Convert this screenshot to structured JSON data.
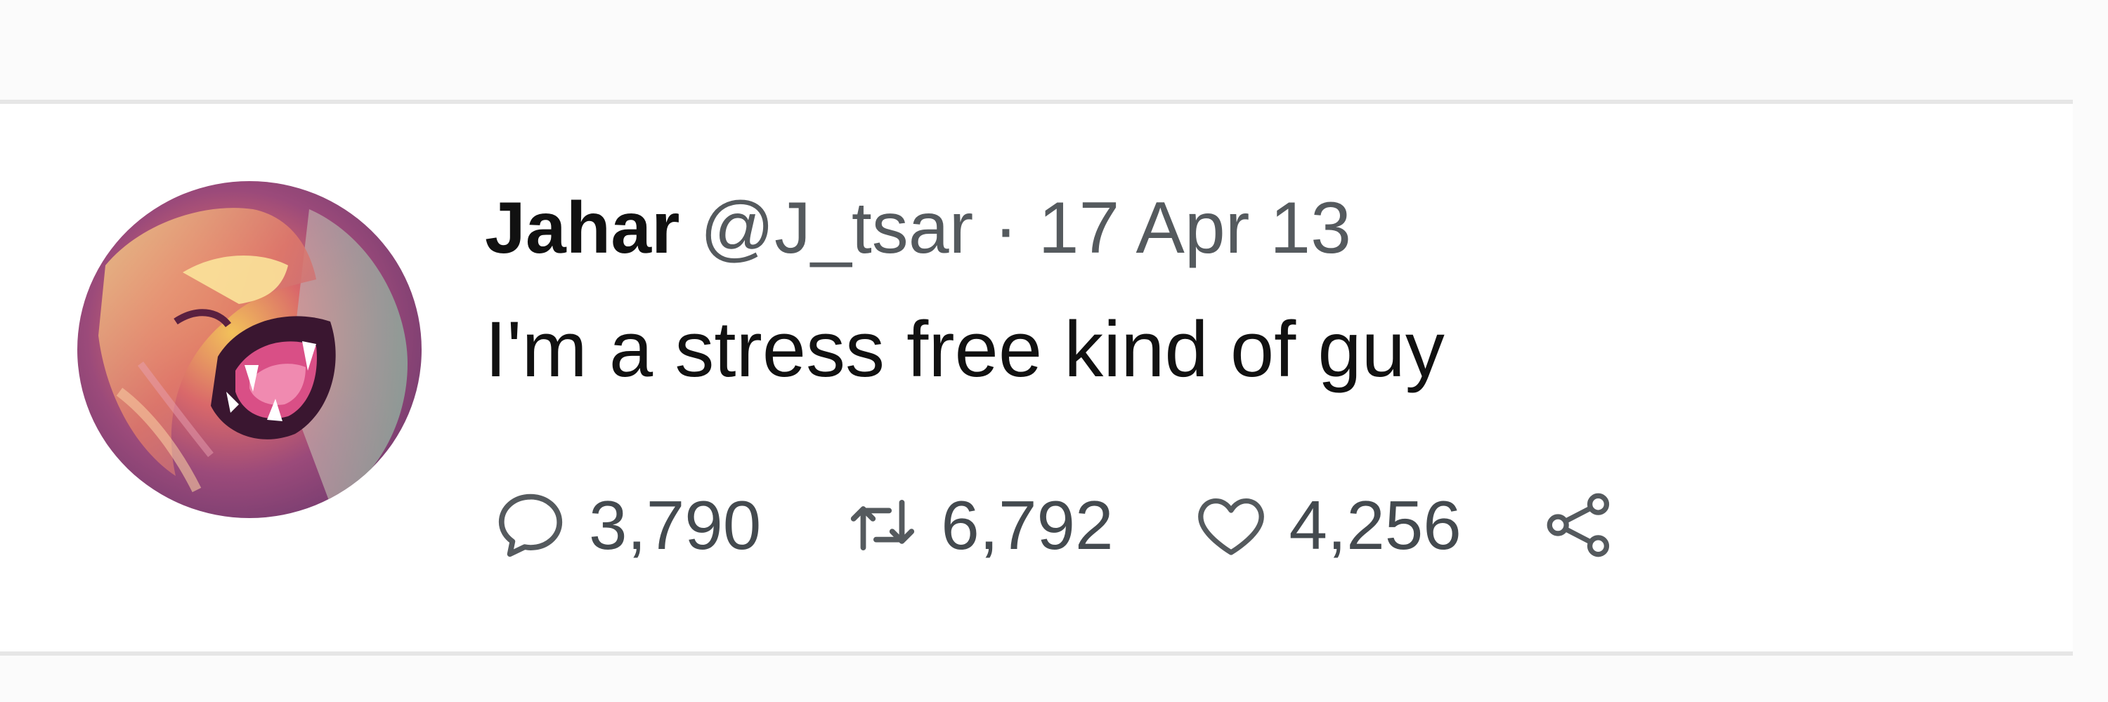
{
  "tweet": {
    "display_name": "Jahar",
    "handle": "@J_tsar",
    "separator": "·",
    "date": "17 Apr 13",
    "text": "I'm a stress free kind of guy",
    "avatar": "lion-roaring-avatar"
  },
  "actions": {
    "reply": {
      "icon": "reply-icon",
      "count": "3,790"
    },
    "retweet": {
      "icon": "retweet-icon",
      "count": "6,792"
    },
    "like": {
      "icon": "heart-icon",
      "count": "4,256"
    },
    "share": {
      "icon": "share-icon"
    }
  },
  "colors": {
    "text_primary": "#111111",
    "text_secondary": "#555a5e",
    "divider": "#e6e6e6"
  }
}
